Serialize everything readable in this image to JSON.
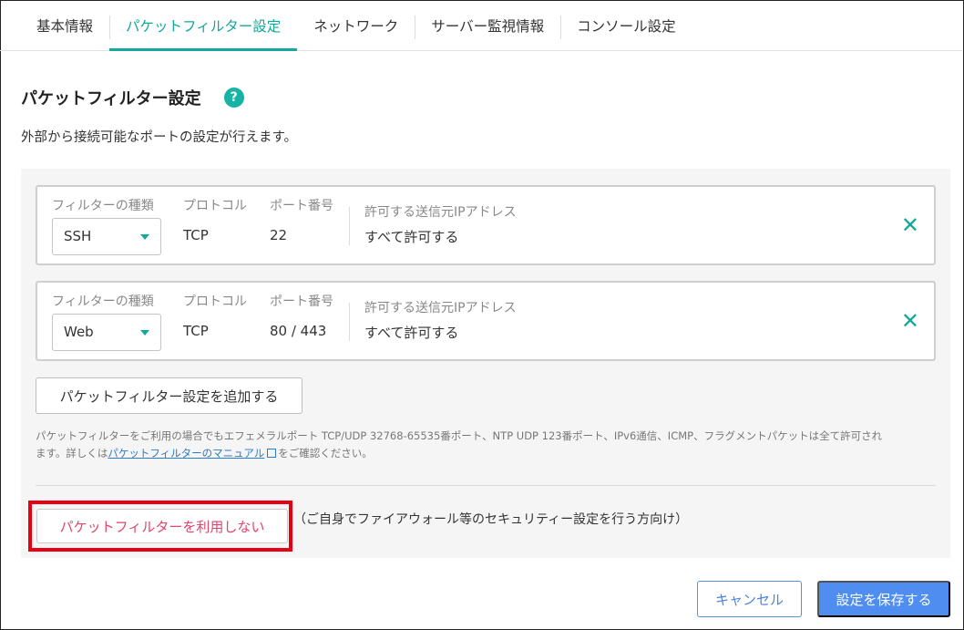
{
  "tabs": [
    {
      "label": "基本情報"
    },
    {
      "label": "パケットフィルター設定"
    },
    {
      "label": "ネットワーク"
    },
    {
      "label": "サーバー監視情報"
    },
    {
      "label": "コンソール設定"
    }
  ],
  "active_tab": "パケットフィルター設定",
  "page": {
    "title": "パケットフィルター設定",
    "help_icon": "?",
    "description": "外部から接続可能なポートの設定が行えます。"
  },
  "filters": [
    {
      "type_label": "フィルターの種類",
      "type_value": "SSH",
      "protocol_label": "プロトコル",
      "protocol_value": "TCP",
      "port_label": "ポート番号",
      "port_value": "22",
      "ip_label": "許可する送信元IPアドレス",
      "ip_value": "すべて許可する",
      "delete_icon": "✕"
    },
    {
      "type_label": "フィルターの種類",
      "type_value": "Web",
      "protocol_label": "プロトコル",
      "protocol_value": "TCP",
      "port_label": "ポート番号",
      "port_value": "80 / 443",
      "ip_label": "許可する送信元IPアドレス",
      "ip_value": "すべて許可する",
      "delete_icon": "✕"
    }
  ],
  "add_button": "パケットフィルター設定を追加する",
  "note": {
    "line1": "パケットフィルターをご利用の場合でもエフェメラルポート TCP/UDP 32768-65535番ポート、NTP UDP 123番ポート、IPv6通信、ICMP、フラグメントパケットは全て許可され",
    "line2_prefix": "ます。詳しくは",
    "link": "パケットフィルターのマニュアル",
    "line2_suffix": "をご確認ください。"
  },
  "disable_button": "パケットフィルターを利用しない",
  "disable_note": "（ご自身でファイアウォール等のセキュリティー設定を行う方向け）",
  "footer": {
    "cancel": "キャンセル",
    "save": "設定を保存する"
  },
  "colors": {
    "accent": "#14a89a",
    "primary": "#4f8ef0",
    "danger_text": "#e0456a",
    "highlight": "#e60012"
  }
}
